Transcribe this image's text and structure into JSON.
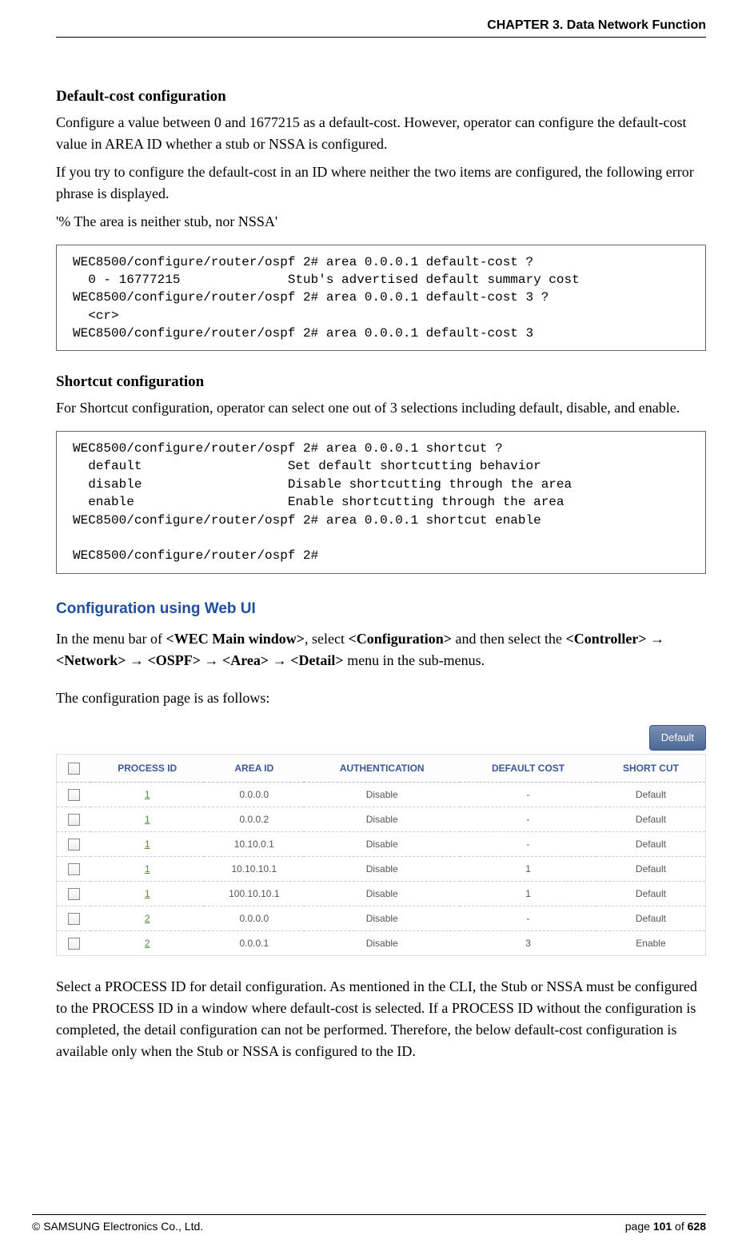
{
  "header": {
    "chapter": "CHAPTER 3. Data Network Function"
  },
  "content": {
    "sec1_title": "Default-cost configuration",
    "sec1_p1": "Configure a value between 0 and 1677215 as a default-cost. However, operator can configure the default-cost value in AREA ID whether a stub or NSSA is configured.",
    "sec1_p2": "If you try to configure the default-cost in an ID where neither the two items are configured, the following error phrase is displayed.",
    "sec1_p3": "'% The area is neither stub, nor NSSA'",
    "code1": "WEC8500/configure/router/ospf 2# area 0.0.0.1 default-cost ?\n  0 - 16777215              Stub's advertised default summary cost\nWEC8500/configure/router/ospf 2# area 0.0.0.1 default-cost 3 ?\n  <cr>\nWEC8500/configure/router/ospf 2# area 0.0.0.1 default-cost 3",
    "sec2_title": "Shortcut configuration",
    "sec2_p1": "For Shortcut configuration, operator can select one out of 3 selections including default, disable, and enable.",
    "code2": "WEC8500/configure/router/ospf 2# area 0.0.0.1 shortcut ?\n  default                   Set default shortcutting behavior\n  disable                   Disable shortcutting through the area\n  enable                    Enable shortcutting through the area\nWEC8500/configure/router/ospf 2# area 0.0.0.1 shortcut enable\n\nWEC8500/configure/router/ospf 2#",
    "sec3_title": "Configuration using Web UI",
    "sec3_p1_a": "In the menu bar of ",
    "sec3_p1_b": "<WEC Main window>",
    "sec3_p1_c": ", select ",
    "sec3_p1_d": "<Configuration>",
    "sec3_p1_e": " and then select the ",
    "sec3_p1_f": "<Controller>",
    "sec3_arrow": " → ",
    "sec3_p1_g": "<Network>",
    "sec3_p1_h": "<OSPF>",
    "sec3_p1_i": "<Area>",
    "sec3_p1_j": "<Detail>",
    "sec3_p1_k": " menu in the sub-menus.",
    "sec3_p2": "The configuration page is as follows:",
    "sec3_p3": "Select a PROCESS ID for detail configuration. As mentioned in the CLI, the Stub or NSSA must be configured to the PROCESS ID in a window where default-cost is selected. If a PROCESS ID without the configuration is completed, the detail configuration can not be performed. Therefore, the below default-cost configuration is available only when the Stub or NSSA is configured to the ID."
  },
  "table": {
    "default_btn": "Default",
    "headers": {
      "process_id": "PROCESS ID",
      "area_id": "AREA ID",
      "authentication": "AUTHENTICATION",
      "default_cost": "DEFAULT COST",
      "short_cut": "SHORT CUT"
    },
    "rows": [
      {
        "pid": "1",
        "area": "0.0.0.0",
        "auth": "Disable",
        "cost": "-",
        "shortcut": "Default"
      },
      {
        "pid": "1",
        "area": "0.0.0.2",
        "auth": "Disable",
        "cost": "-",
        "shortcut": "Default"
      },
      {
        "pid": "1",
        "area": "10.10.0.1",
        "auth": "Disable",
        "cost": "-",
        "shortcut": "Default"
      },
      {
        "pid": "1",
        "area": "10.10.10.1",
        "auth": "Disable",
        "cost": "1",
        "shortcut": "Default"
      },
      {
        "pid": "1",
        "area": "100.10.10.1",
        "auth": "Disable",
        "cost": "1",
        "shortcut": "Default"
      },
      {
        "pid": "2",
        "area": "0.0.0.0",
        "auth": "Disable",
        "cost": "-",
        "shortcut": "Default"
      },
      {
        "pid": "2",
        "area": "0.0.0.1",
        "auth": "Disable",
        "cost": "3",
        "shortcut": "Enable"
      }
    ]
  },
  "footer": {
    "copyright": "© SAMSUNG Electronics Co., Ltd.",
    "page_prefix": "page ",
    "page_current": "101",
    "page_sep": " of ",
    "page_total": "628"
  }
}
